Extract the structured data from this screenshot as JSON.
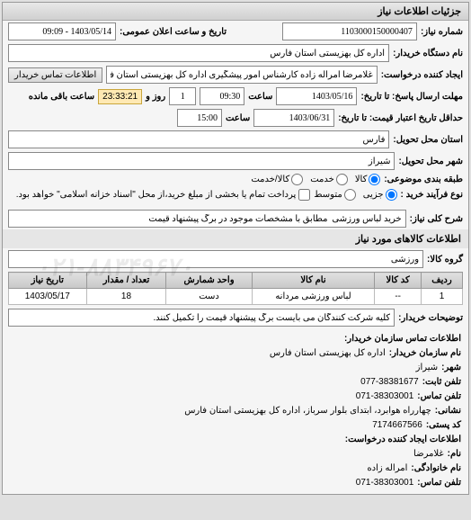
{
  "panel": {
    "title": "جزئیات اطلاعات نیاز"
  },
  "fields": {
    "request_no_label": "شماره نیاز:",
    "request_no": "1103000150000407",
    "announce_label": "تاریخ و ساعت اعلان عمومی:",
    "announce_value": "1403/05/14 - 09:09",
    "buyer_org_label": "نام دستگاه خریدار:",
    "buyer_org": "اداره کل بهزیستی استان فارس",
    "requester_label": "ایجاد کننده درخواست:",
    "requester": "غلامرضا امراله زاده کارشناس امور پیشگیری اداره کل بهزیستی استان فارس",
    "buyer_contact_btn": "اطلاعات تماس خریدار",
    "deadline_label": "مهلت ارسال پاسخ: تا تاریخ:",
    "deadline_date": "1403/05/16",
    "time_label": "ساعت",
    "deadline_time": "09:30",
    "days_remaining": "1",
    "day_word": "روز و",
    "timer": "23:33:21",
    "timer_suffix": "ساعت باقی مانده",
    "validity_label": "حداقل تاریخ اعتبار قیمت: تا تاریخ:",
    "validity_date": "1403/06/31",
    "validity_time": "15:00",
    "delivery_province_label": "استان محل تحویل:",
    "delivery_province": "فارس",
    "delivery_city_label": "شهر محل تحویل:",
    "delivery_city": "شیراز",
    "category_label": "طبقه بندی موضوعی:",
    "cat_goods": "کالا",
    "cat_service": "خدمت",
    "cat_goods_service": "کالا/خدمت",
    "purchase_type_label": "نوع فرآیند خرید :",
    "pt_minor": "جزیی",
    "pt_medium": "متوسط",
    "pt_note": "پرداخت تمام یا بخشی از مبلغ خرید،از محل \"اسناد خزانه اسلامی\" خواهد بود.",
    "subject_label": "شرح کلی نیاز:",
    "subject": "خرید لباس ورزشی  مطابق با مشخصات موجود در برگ پیشنهاد قیمت",
    "goods_section": "اطلاعات کالاهای مورد نیاز",
    "goods_group_label": "گروه کالا:",
    "goods_group": "ورزشی"
  },
  "table": {
    "headers": {
      "row": "ردیف",
      "code": "کد کالا",
      "name": "نام کالا",
      "unit": "واحد شمارش",
      "qty": "تعداد / مقدار",
      "date": "تاریخ نیاز"
    },
    "rows": [
      {
        "idx": "1",
        "code": "--",
        "name": "لباس ورزشی مردانه",
        "unit": "دست",
        "qty": "18",
        "date": "1403/05/17"
      }
    ]
  },
  "buyer_notes": {
    "label": "توضیحات خریدار:",
    "text": "کلیه شرکت کنندگان می بایست برگ پیشنهاد قیمت را تکمیل کنند."
  },
  "contact": {
    "header": "اطلاعات تماس سازمان خریدار:",
    "org_label": "نام سازمان  خریدار:",
    "org": "اداره کل بهزیستی استان فارس",
    "city_label": "شهر:",
    "city": "شیراز",
    "phone_label": "تلفن ثابت:",
    "phone": "077-38381677",
    "fax_label": "تلفن تماس:",
    "fax": "071-38303001",
    "address_label": "نشانی:",
    "address": "چهارراه هوابرد، ابتدای بلوار سرباز، اداره کل بهزیستی استان فارس",
    "postal_label": "کد پستی:",
    "postal": "7174667566",
    "requester_header": "اطلاعات ایجاد کننده درخواست:",
    "fname_label": "نام:",
    "fname": "غلامرضا",
    "lname_label": "نام خانوادگی:",
    "lname": "امراله زاده",
    "req_phone_label": "تلفن تماس:",
    "req_phone": "071-38303001"
  },
  "watermark": "۰۲۱-۸۸۳۴۹۶۷۰"
}
